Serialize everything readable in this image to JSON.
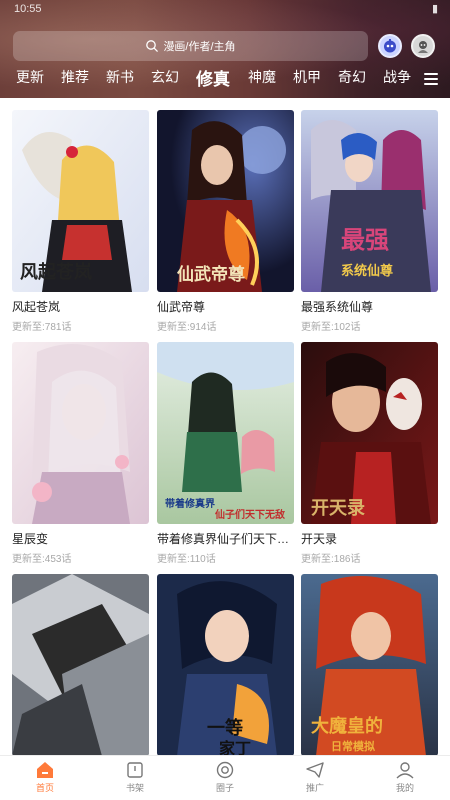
{
  "status_bar": {
    "time": "10:55"
  },
  "search": {
    "placeholder": "漫画/作者/主角"
  },
  "categories": [
    "更新",
    "推荐",
    "新书",
    "玄幻",
    "修真",
    "神魔",
    "机甲",
    "奇幻",
    "战争"
  ],
  "active_category": "修真",
  "update_prefix": "更新至:",
  "comics": [
    {
      "title": "风起苍岚",
      "chapter": "781话",
      "cover_text": "风起苍岚",
      "colors": [
        "#e9eef8",
        "#c6312f",
        "#1a1a1a"
      ]
    },
    {
      "title": "仙武帝尊",
      "chapter": "914话",
      "cover_text": "仙武帝尊",
      "colors": [
        "#1c1f3e",
        "#e8611d",
        "#8a1d1d"
      ]
    },
    {
      "title": "最强系统仙尊",
      "chapter": "102话",
      "cover_text": "最强系统仙尊",
      "colors": [
        "#a9b8d8",
        "#5c4b8f",
        "#d8457a"
      ]
    },
    {
      "title": "星辰变",
      "chapter": "453话",
      "cover_text": "",
      "colors": [
        "#f1e4e9",
        "#e3b6c6",
        "#b8a4c9"
      ]
    },
    {
      "title": "带着修真界仙子们天下无敌",
      "chapter": "110话",
      "cover_text": "带着修真界仙子们天下无敌",
      "colors": [
        "#cfe0c6",
        "#2e6f4a",
        "#e99aa5"
      ]
    },
    {
      "title": "开天录",
      "chapter": "186话",
      "cover_text": "开天录",
      "colors": [
        "#3a1212",
        "#b72222",
        "#e2c7a4"
      ]
    },
    {
      "title": "",
      "chapter": "",
      "cover_text": "",
      "colors": [
        "#5a5f66",
        "#c9ccd1",
        "#2b2b2b"
      ]
    },
    {
      "title": "",
      "chapter": "",
      "cover_text": "一等家丁",
      "colors": [
        "#1c2a4a",
        "#f2a23a",
        "#d8dbe2"
      ]
    },
    {
      "title": "",
      "chapter": "",
      "cover_text": "大魔皇的日常模拟",
      "colors": [
        "#3a4f6e",
        "#d24a22",
        "#f0b23c"
      ]
    }
  ],
  "tabs": [
    {
      "label": "首页",
      "icon": "home-icon",
      "active": true
    },
    {
      "label": "书架",
      "icon": "bookshelf-icon",
      "active": false
    },
    {
      "label": "圈子",
      "icon": "circle-icon",
      "active": false
    },
    {
      "label": "推广",
      "icon": "promote-icon",
      "active": false
    },
    {
      "label": "我的",
      "icon": "user-icon",
      "active": false
    }
  ],
  "theme": {
    "accent": "#ff7a3a"
  }
}
